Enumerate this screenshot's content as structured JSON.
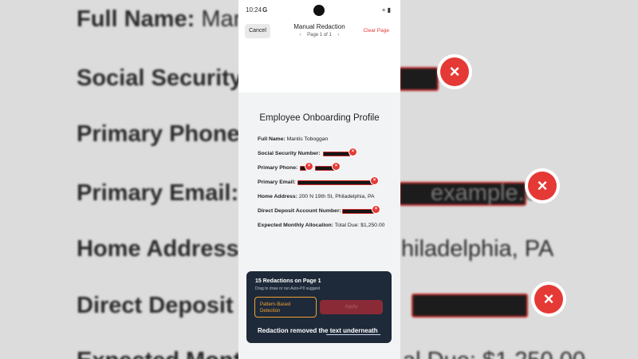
{
  "background": {
    "full_name_label": "Full Name:",
    "full_name_value": "Manti",
    "ssn_label": "Social Security",
    "phone_label": "Primary Phone:",
    "email_label": "Primary Email:",
    "email_tail": "example.co",
    "address_label": "Home Address:",
    "address_tail": "hiladelphia, PA",
    "deposit_label": "Direct Deposit A",
    "expected_label": "Expected Month",
    "expected_tail": "al Due: $1,250.00"
  },
  "status_bar": {
    "time": "10:24",
    "g": "G",
    "icons": "+ ▮"
  },
  "top_bar": {
    "cancel_label": "Cancel",
    "title": "Manual Redaction",
    "page_indicator": "Page 1 of 1",
    "prev": "‹",
    "next": "›",
    "clear_label": "Clear Page"
  },
  "document": {
    "title": "Employee Onboarding Profile",
    "fields": [
      {
        "label": "Full Name:",
        "value": "Mantis Toboggan"
      },
      {
        "label": "Social Security Number:",
        "value": ""
      },
      {
        "label": "Primary Phone:",
        "value": ""
      },
      {
        "label": "Primary Email:",
        "value": ""
      },
      {
        "label": "Home Address:",
        "value": "200 N 19th St, Philadelphia, PA"
      },
      {
        "label": "Direct Deposit Account Number:",
        "value": ""
      },
      {
        "label": "Expected Monthly Allocation:",
        "value": "Total Due: $1,250.00"
      }
    ]
  },
  "panel": {
    "title": "15 Redactions on Page 1",
    "subtitle": "Drag to draw or run Auto-PII suggest",
    "pattern_button": "Pattern-Based Detection",
    "apply_button": "Apply",
    "toast": "Redaction removed the text underneath"
  },
  "colors": {
    "accent_red": "#e53935",
    "panel_bg": "#1e2a3a",
    "pattern_orange": "#f0a030"
  }
}
